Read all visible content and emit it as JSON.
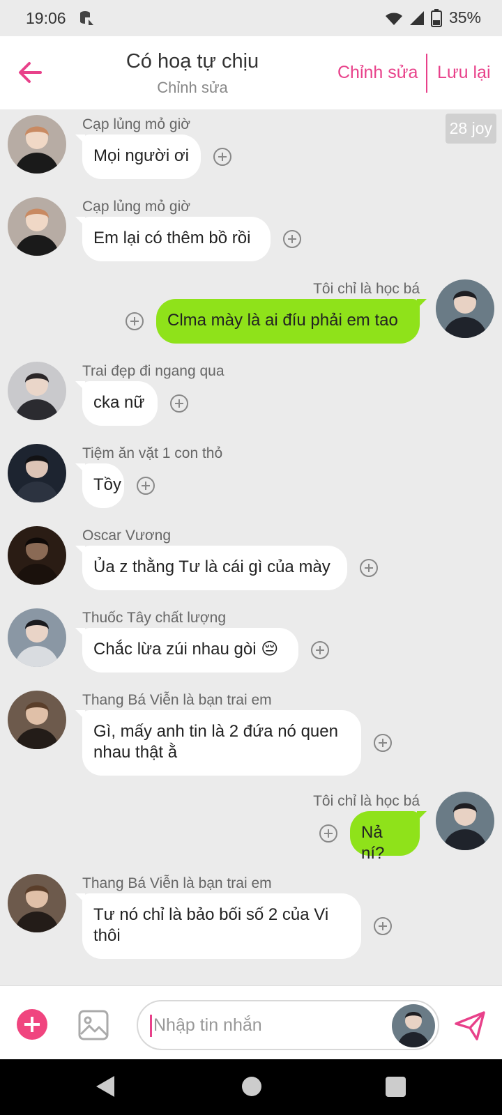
{
  "status_bar": {
    "time": "19:06",
    "battery": "35%"
  },
  "header": {
    "title": "Có hoạ tự chịu",
    "subtitle": "Chỉnh sửa",
    "edit_label": "Chỉnh sửa",
    "save_label": "Lưu lại"
  },
  "chat": {
    "badge": "28 joy",
    "messages": [
      {
        "side": "left",
        "sender": "Cạp lủng mỏ giờ",
        "text": "Mọi người ơi"
      },
      {
        "side": "left",
        "sender": "Cạp lủng mỏ giờ",
        "text": "Em lại có thêm bồ rồi"
      },
      {
        "side": "right",
        "sender": "Tôi chỉ là học bá",
        "text": "Clma mày là ai đíu phải em tao"
      },
      {
        "side": "left",
        "sender": "Trai đẹp đi ngang qua",
        "text": "cka nữ"
      },
      {
        "side": "left",
        "sender": "Tiệm ăn vặt 1 con thỏ",
        "text": "Tồy"
      },
      {
        "side": "left",
        "sender": "Oscar Vương",
        "text": "Ủa z thằng Tư là cái gì của mày"
      },
      {
        "side": "left",
        "sender": "Thuốc Tây chất lượng",
        "text": "Chắc lừa zúi nhau gòi 😔"
      },
      {
        "side": "left",
        "sender": "Thang Bá Viễn là bạn trai em",
        "text": "Gì, mấy anh tin là 2 đứa nó quen nhau thật ằ"
      },
      {
        "side": "right",
        "sender": "Tôi chỉ là học bá",
        "text": "Nả ní?"
      },
      {
        "side": "left",
        "sender": "Thang Bá Viễn là bạn trai em",
        "text": "Tư nó chỉ là bảo bối số 2 của Vi thôi"
      }
    ]
  },
  "composer": {
    "placeholder": "Nhập tin nhắn",
    "value": ""
  },
  "icons": {
    "back": "arrow-left-icon",
    "add": "plus-icon",
    "image": "image-icon",
    "send": "send-icon",
    "react": "add-reaction-icon"
  },
  "colors": {
    "accent": "#e8418a",
    "own_bubble": "#8fe21a",
    "background": "#ebebeb"
  }
}
